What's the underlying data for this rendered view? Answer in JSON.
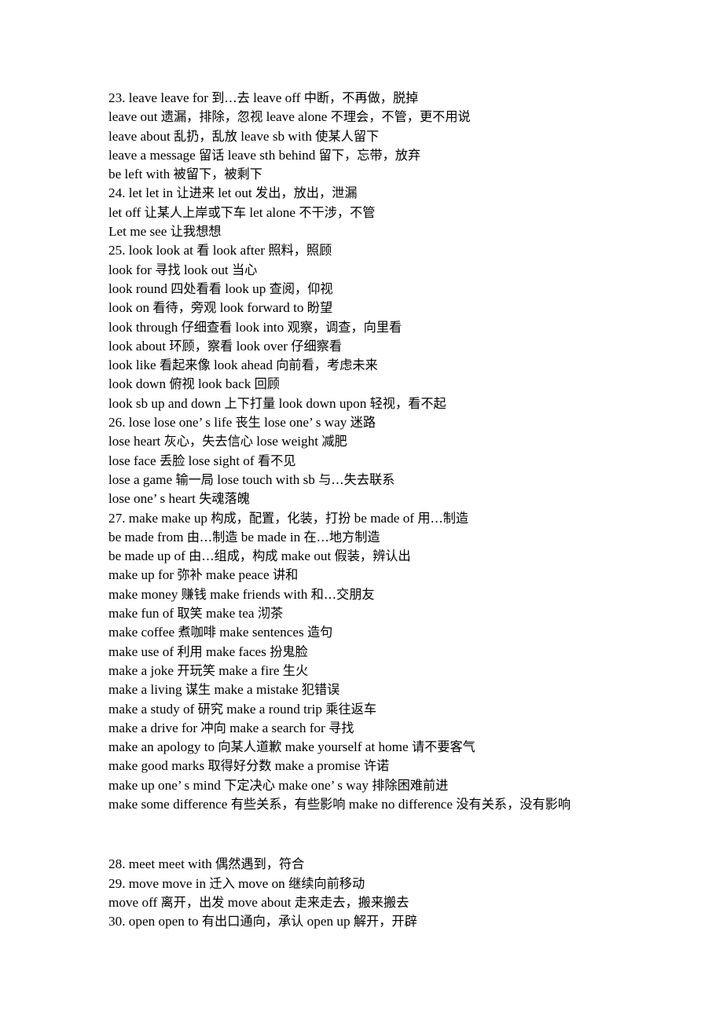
{
  "document": {
    "type": "study-notes",
    "language": "en-zh",
    "background_color": "#ffffff",
    "text_color": "#000000",
    "blocks": [
      {
        "id": "block-main",
        "lines": [
          "23. leave leave for  到…去  leave off  中断，不再做，脱掉",
          "leave out  遗漏，排除，忽视  leave alone  不理会，不管，更不用说",
          "leave about  乱扔，乱放  leave sb with  使某人留下",
          "leave a message  留话  leave sth behind  留下，忘带，放弃",
          "be left with  被留下，被剩下",
          "24. let let in  让进来  let out  发出，放出，泄漏",
          "let off  让某人上岸或下车  let alone  不干涉，不管",
          "Let me see  让我想想",
          "25. look look at  看  look after  照料，照顾",
          "look for  寻找  look out  当心",
          "look round  四处看看  look up  查阅，仰视",
          "look on  看待，旁观  look forward to  盼望",
          "look through  仔细查看  look into  观察，调查，向里看",
          "look about  环顾，察看  look over  仔细察看",
          "look like  看起来像  look ahead  向前看，考虑未来",
          "look down  俯视  look back  回顾",
          "look sb up and down  上下打量  look down upon  轻视，看不起",
          "26. lose lose one’ s life  丧生  lose one’ s way  迷路",
          "lose heart  灰心，失去信心  lose weight  减肥",
          "lose face  丢脸  lose sight of  看不见",
          "lose a game  输一局  lose touch with sb  与…失去联系",
          "lose one’ s heart  失魂落魄",
          "27. make make up  构成，配置，化装，打扮  be made of  用…制造",
          "be made from  由…制造  be made in  在…地方制造",
          "be made up of  由…组成，构成  make out  假装，辨认出",
          "make up for  弥补  make peace  讲和",
          "make money  赚钱  make friends with  和…交朋友",
          "make fun of  取笑  make tea  沏茶",
          "make coffee  煮咖啡  make sentences  造句",
          "make use of  利用  make faces  扮鬼脸",
          "make a joke  开玩笑  make a fire  生火",
          "make a living  谋生  make a mistake  犯错误",
          "make a study of  研究  make a round trip  乘往返车",
          "make a drive for  冲向  make a search for  寻找",
          "make an apology to  向某人道歉  make yourself at home  请不要客气",
          "make good marks  取得好分数  make a promise  许诺",
          "make up one’ s mind  下定决心  make one’ s way  排除困难前进",
          "make some difference  有些关系，有些影响  make no difference  没有关系，没有影响"
        ]
      },
      {
        "id": "block-tail",
        "lines": [
          "28. meet meet with  偶然遇到，符合",
          "29. move move in  迁入  move on  继续向前移动",
          "move off  离开，出发  move about  走来走去，搬来搬去",
          "30. open open to  有出口通向，承认  open up  解开，开辟"
        ]
      }
    ]
  }
}
